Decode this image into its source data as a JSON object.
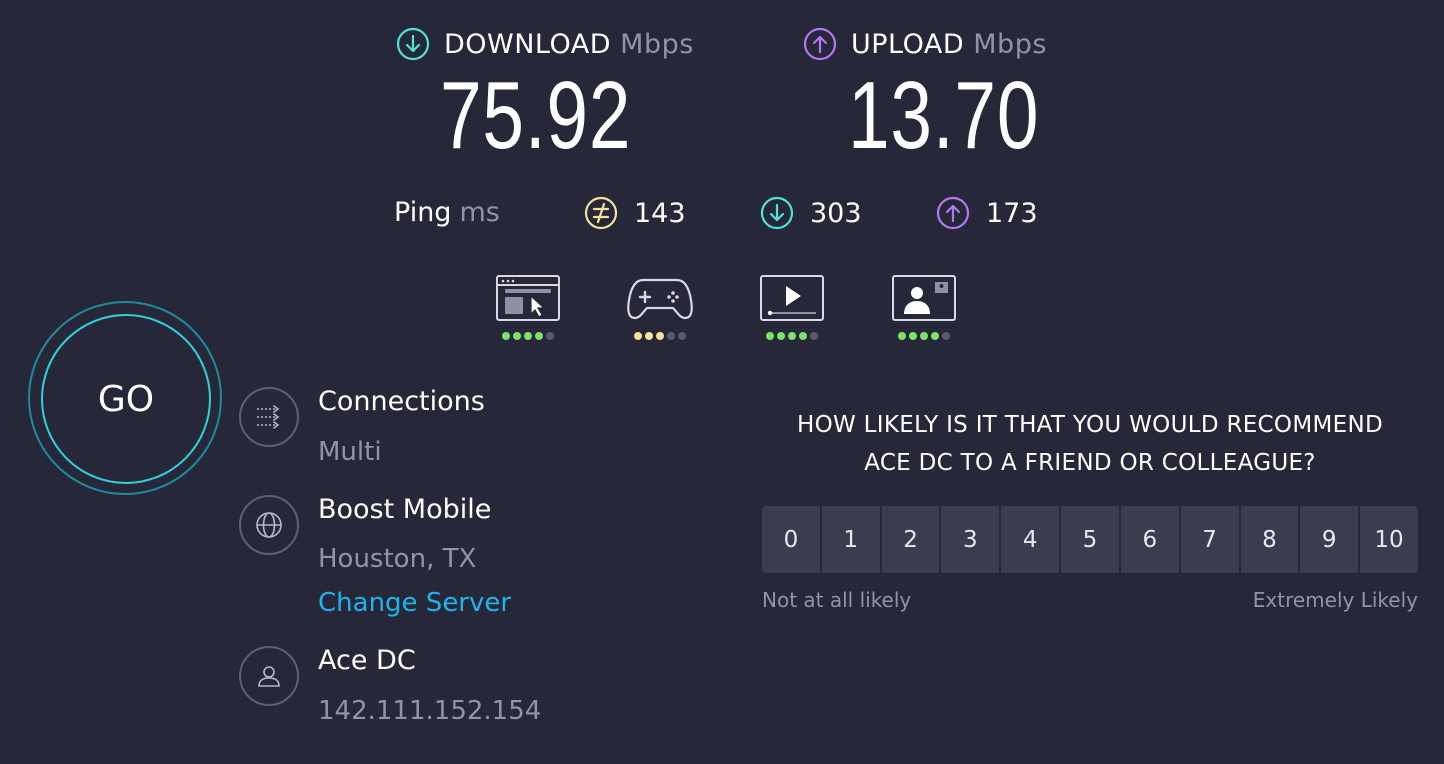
{
  "download": {
    "label": "DOWNLOAD",
    "unit": "Mbps",
    "value": "75.92",
    "icon": "arrow-down-circle-icon",
    "color": "#4fe3d7"
  },
  "upload": {
    "label": "UPLOAD",
    "unit": "Mbps",
    "value": "13.70",
    "icon": "arrow-up-circle-icon",
    "color": "#b478f2"
  },
  "ping": {
    "label": "Ping",
    "unit": "ms",
    "idle": {
      "value": "143",
      "icon": "idle-latency-icon",
      "color": "#f3e39a"
    },
    "download": {
      "value": "303",
      "icon": "arrow-down-circle-icon",
      "color": "#4fe3d7"
    },
    "upload": {
      "value": "173",
      "icon": "arrow-up-circle-icon",
      "color": "#b478f2"
    }
  },
  "services": [
    {
      "icon": "web-browsing-icon",
      "rating": 4,
      "max": 5,
      "color": "#7be36a"
    },
    {
      "icon": "gaming-controller-icon",
      "rating": 3,
      "max": 5,
      "color": "#f3e39a"
    },
    {
      "icon": "video-streaming-icon",
      "rating": 4,
      "max": 5,
      "color": "#7be36a"
    },
    {
      "icon": "video-chat-icon",
      "rating": 4,
      "max": 5,
      "color": "#7be36a"
    }
  ],
  "go_label": "GO",
  "connections": {
    "title": "Connections",
    "value": "Multi",
    "icon": "connections-icon"
  },
  "server": {
    "name": "Boost Mobile",
    "location": "Houston, TX",
    "change_label": "Change Server",
    "icon": "globe-icon"
  },
  "host": {
    "name": "Ace DC",
    "ip": "142.111.152.154",
    "icon": "person-icon"
  },
  "survey": {
    "question_line1": "HOW LIKELY IS IT THAT YOU WOULD RECOMMEND",
    "question_line2": "ACE DC TO A FRIEND OR COLLEAGUE?",
    "options": [
      "0",
      "1",
      "2",
      "3",
      "4",
      "5",
      "6",
      "7",
      "8",
      "9",
      "10"
    ],
    "low_label": "Not at all likely",
    "high_label": "Extremely Likely"
  }
}
